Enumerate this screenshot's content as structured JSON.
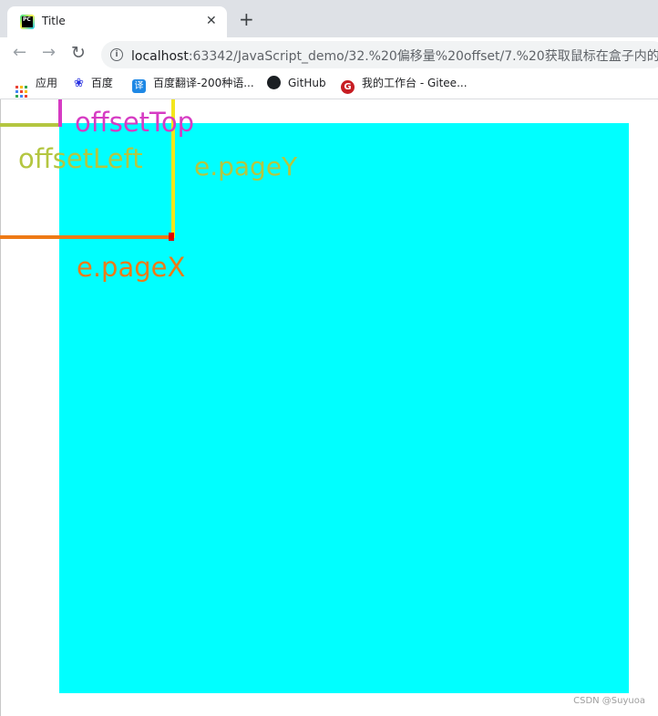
{
  "tab": {
    "title": "Title",
    "favicon": "pycharm-icon",
    "close": "✕",
    "new_tab": "+"
  },
  "toolbar": {
    "back": "←",
    "forward": "→",
    "reload": "↻",
    "url_host": "localhost",
    "url_path": ":63342/JavaScript_demo/32.%20偏移量%20offset/7.%20获取鼠标在盒子内的坐..."
  },
  "bookmarks": [
    {
      "label": "应用",
      "icon": "apps-grid-icon"
    },
    {
      "label": "百度",
      "icon": "baidu-paw-icon"
    },
    {
      "label": "百度翻译-200种语...",
      "icon": "translate-icon"
    },
    {
      "label": "GitHub",
      "icon": "github-icon"
    },
    {
      "label": "我的工作台 - Gitee...",
      "icon": "gitee-icon"
    }
  ],
  "annotations": {
    "offset_top": "offsetTop",
    "offset_left": "offsetLeft",
    "page_y": "e.pageY",
    "page_x": "e.pageX"
  },
  "colors": {
    "box": "#00ffff",
    "offset_top": "#d63bc3",
    "offset_left": "#b4c640",
    "page_y_line": "#f3e61c",
    "page_x_line": "#ee7a16",
    "cursor": "#e00000"
  },
  "watermark": "CSDN @Suyuoa"
}
